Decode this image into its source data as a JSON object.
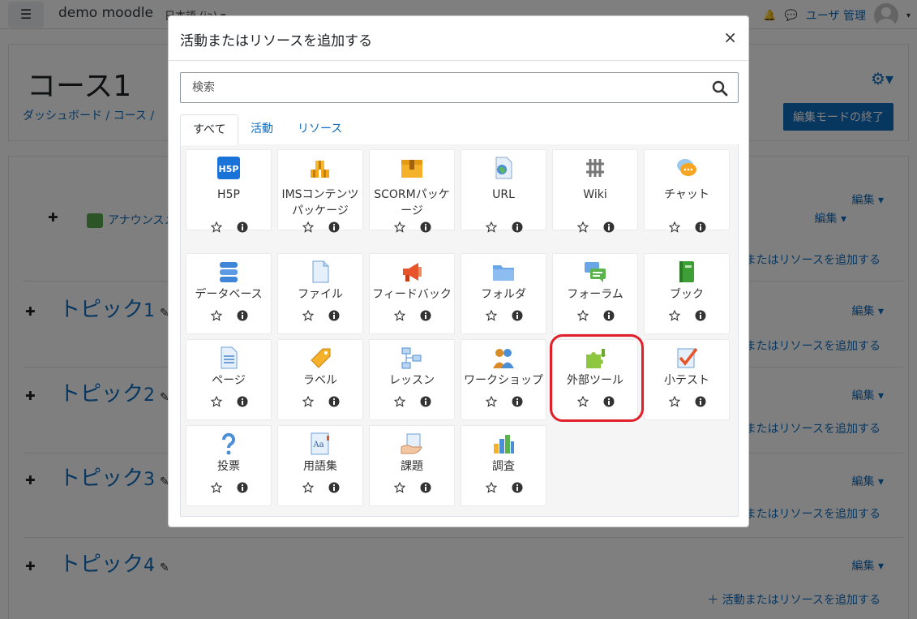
{
  "navbar": {
    "menu_icon": "hamburger-icon",
    "brand": "demo moodle",
    "language": "日本語 ‎(ja)‎ ▾",
    "user": "ユーザ 管理",
    "bell_icon": "bell-icon",
    "chat_icon": "chat-icon"
  },
  "course": {
    "title": "コース1",
    "breadcrumb": "ダッシュボード / コース / ",
    "edit_mode_button": "編集モードの終了"
  },
  "background": {
    "announcement": "アナウンスメン",
    "edit_label": "編集 ▾",
    "edit_user_label": "編集 ▾",
    "add_link": "活動またはリソースを追加する",
    "add_link_full": "＋ 活動またはリソースを追加する",
    "topics": [
      {
        "title": "トピック",
        "number": "1"
      },
      {
        "title": "トピック",
        "number": "2"
      },
      {
        "title": "トピック",
        "number": "3"
      },
      {
        "title": "トピック",
        "number": "4"
      }
    ]
  },
  "modal": {
    "title": "活動またはリソースを追加する",
    "close": "×",
    "search_placeholder": "検索",
    "search_value": "",
    "tabs": [
      {
        "label": "すべて",
        "active": true
      },
      {
        "label": "活動",
        "active": false
      },
      {
        "label": "リソース",
        "active": false
      }
    ],
    "items": [
      {
        "name": "H5P",
        "icon": "h5p-icon"
      },
      {
        "name": "IMSコンテンツパッケージ",
        "line1": "IMSコンテンツ",
        "line2": "パッケージ",
        "icon": "ims-package-icon"
      },
      {
        "name": "SCORMパッケージ",
        "line1": "SCORMパッケ",
        "line2": "ージ",
        "icon": "scorm-icon"
      },
      {
        "name": "URL",
        "icon": "url-icon"
      },
      {
        "name": "Wiki",
        "icon": "wiki-icon"
      },
      {
        "name": "チャット",
        "icon": "chat-icon"
      },
      {
        "name": "データベース",
        "icon": "database-icon"
      },
      {
        "name": "ファイル",
        "icon": "file-icon"
      },
      {
        "name": "フィードバック",
        "icon": "feedback-icon"
      },
      {
        "name": "フォルダ",
        "icon": "folder-icon"
      },
      {
        "name": "フォーラム",
        "icon": "forum-icon"
      },
      {
        "name": "ブック",
        "icon": "book-icon"
      },
      {
        "name": "ページ",
        "icon": "page-icon"
      },
      {
        "name": "ラベル",
        "icon": "label-icon"
      },
      {
        "name": "レッスン",
        "icon": "lesson-icon"
      },
      {
        "name": "ワークショップ",
        "icon": "workshop-icon"
      },
      {
        "name": "外部ツール",
        "icon": "external-tool-icon",
        "highlighted": true
      },
      {
        "name": "小テスト",
        "icon": "quiz-icon"
      },
      {
        "name": "投票",
        "icon": "choice-icon"
      },
      {
        "name": "用語集",
        "icon": "glossary-icon"
      },
      {
        "name": "課題",
        "icon": "assignment-icon"
      },
      {
        "name": "調査",
        "icon": "survey-icon"
      }
    ]
  },
  "colors": {
    "link": "#0f6cbf",
    "highlight": "#e0202a",
    "overlay": "rgba(0,0,0,0.5)"
  }
}
